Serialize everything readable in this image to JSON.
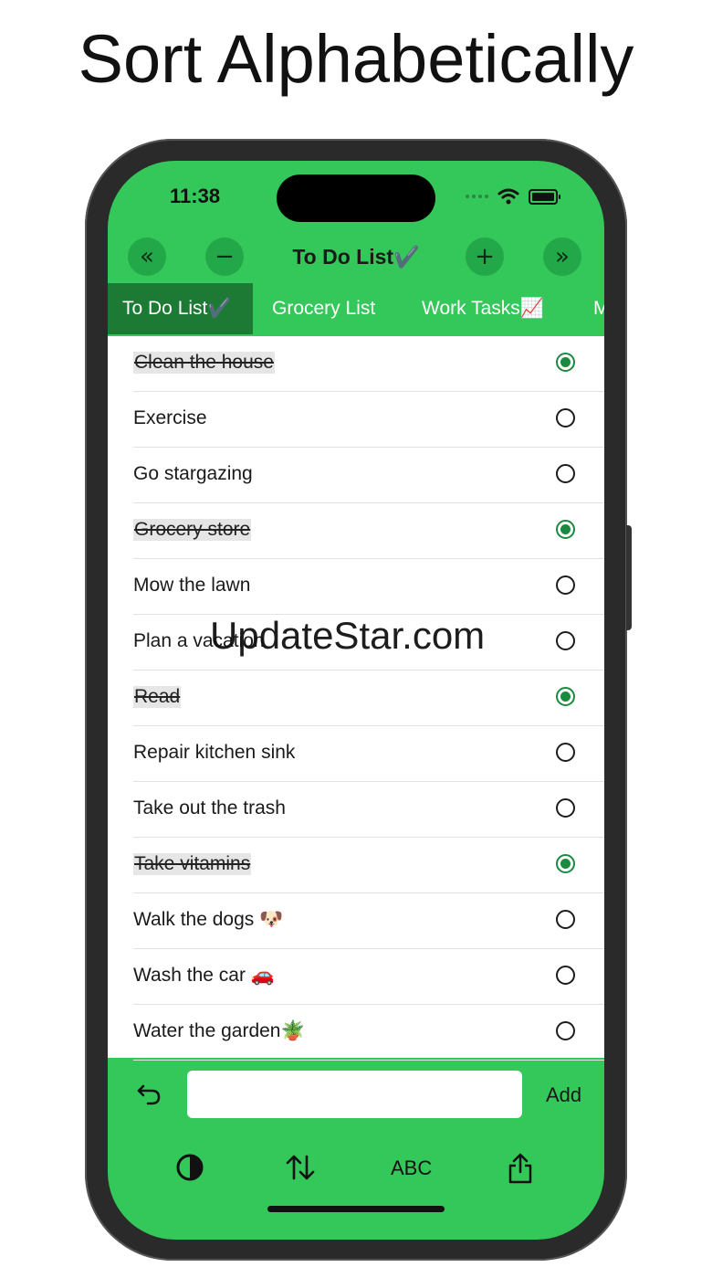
{
  "headline": "Sort Alphabetically",
  "status": {
    "time": "11:38"
  },
  "nav": {
    "title": "To Do List✔️",
    "prev_icon": "«",
    "minus_icon": "−",
    "plus_icon": "+",
    "next_icon": "»"
  },
  "tabs": [
    {
      "label": "To Do List✔️",
      "active": true
    },
    {
      "label": "Grocery List",
      "active": false
    },
    {
      "label": "Work Tasks📈",
      "active": false
    },
    {
      "label": "M",
      "active": false
    }
  ],
  "items": [
    {
      "text": "Clean the house",
      "done": true
    },
    {
      "text": "Exercise",
      "done": false
    },
    {
      "text": "Go stargazing",
      "done": false
    },
    {
      "text": "Grocery store",
      "done": true
    },
    {
      "text": "Mow the lawn",
      "done": false
    },
    {
      "text": "Plan a vacation",
      "done": false
    },
    {
      "text": "Read",
      "done": true
    },
    {
      "text": "Repair kitchen sink",
      "done": false
    },
    {
      "text": "Take out the trash",
      "done": false
    },
    {
      "text": "Take vitamins",
      "done": true
    },
    {
      "text": "Walk the dogs 🐶",
      "done": false
    },
    {
      "text": "Wash the car 🚗",
      "done": false
    },
    {
      "text": "Water the garden🪴",
      "done": false
    }
  ],
  "watermark": "UpdateStar.com",
  "composer": {
    "value": "",
    "add_label": "Add"
  },
  "toolbar": {
    "abc_label": "ABC"
  },
  "colors": {
    "accent": "#34c759",
    "active_tab": "#1d7a35",
    "checked": "#1a8a3e"
  }
}
